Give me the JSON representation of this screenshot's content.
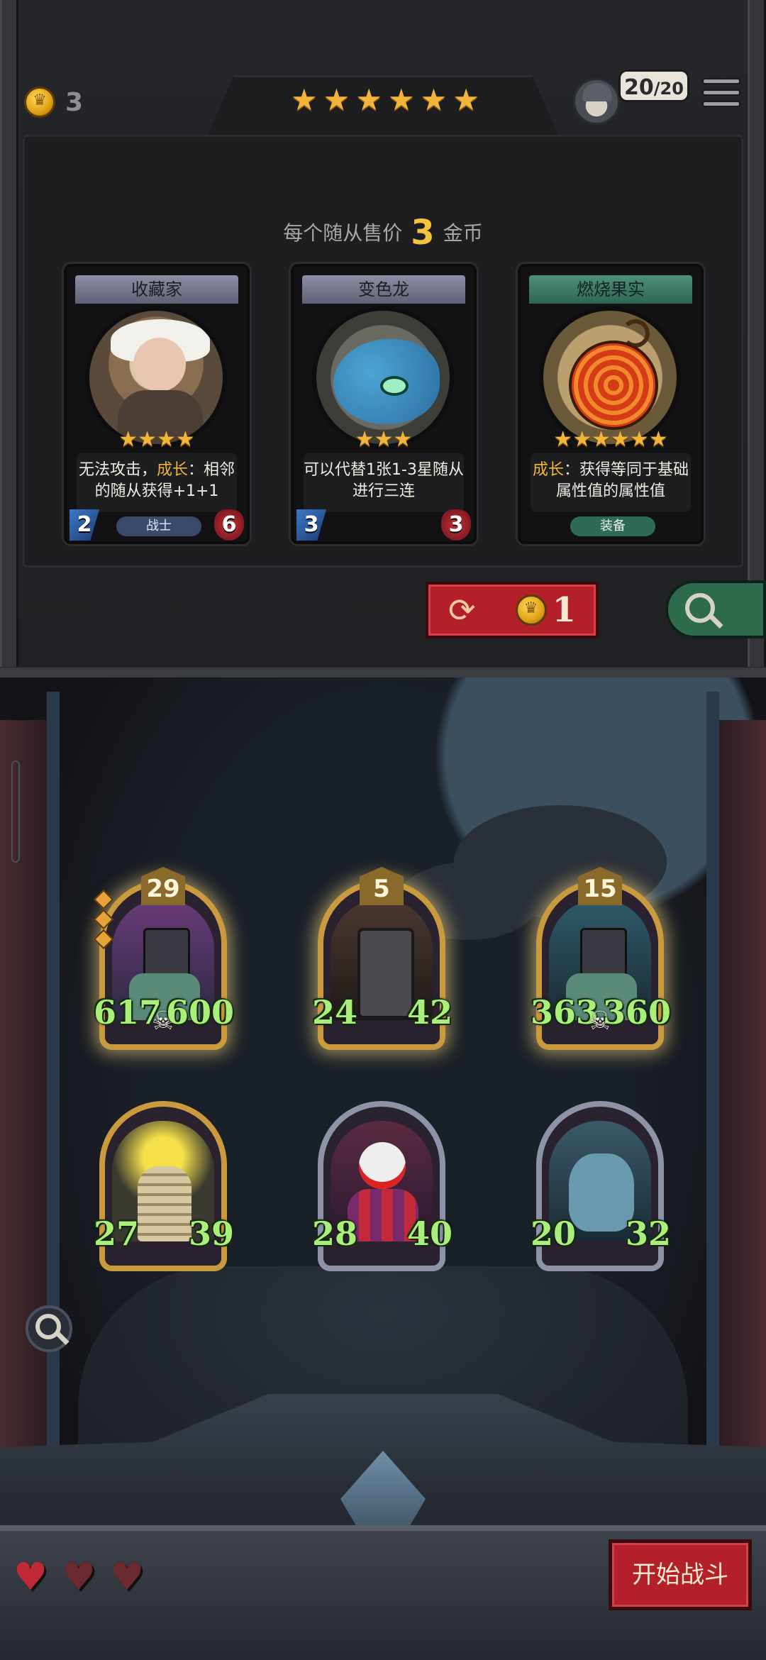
{
  "shop": {
    "gold": "3",
    "tier_stars": 6,
    "population": "20",
    "population_max": "/20",
    "sell_prefix": "每个随从售价",
    "sell_price": "3",
    "sell_suffix": "金币",
    "refresh_cost": "1"
  },
  "cards": [
    {
      "name": "收藏家",
      "stars": 4,
      "desc_plain": "无法攻击，",
      "desc_highlight": "成长",
      "desc_rest": "：相邻的随从获得+1+1",
      "attack": "2",
      "health": "6",
      "tag": "战士",
      "portrait_icon": "collector-portrait"
    },
    {
      "name": "变色龙",
      "stars": 3,
      "desc_plain": "可以代替1张1-3星随从进行三连",
      "attack": "3",
      "health": "3",
      "tag": "",
      "portrait_icon": "chameleon-portrait"
    },
    {
      "name": "燃烧果实",
      "stars": 6,
      "desc_highlight": "成长",
      "desc_rest": "：获得等同于基础属性值的属性值",
      "tag": "装备",
      "portrait_icon": "burning-fruit-portrait"
    }
  ],
  "board": {
    "row1": [
      {
        "level": "29",
        "attack": "617",
        "health": "600",
        "skull": true,
        "pips": 3,
        "art": "armored-knight"
      },
      {
        "level": "5",
        "attack": "24",
        "health": "42",
        "skull": false,
        "art": "shield-bearer"
      },
      {
        "level": "15",
        "attack": "363",
        "health": "360",
        "skull": true,
        "art": "armored-knight"
      }
    ],
    "row2": [
      {
        "attack": "27",
        "health": "39",
        "art": "flame-mummy"
      },
      {
        "attack": "28",
        "health": "40",
        "art": "clown"
      },
      {
        "attack": "20",
        "health": "32",
        "art": "horned-beast"
      }
    ]
  },
  "lives": [
    true,
    false,
    false
  ],
  "start_battle": "开始战斗",
  "colors": {
    "gold": "#f3b43c",
    "stat_green": "#a9ef7a",
    "button_red": "#b4202a"
  }
}
